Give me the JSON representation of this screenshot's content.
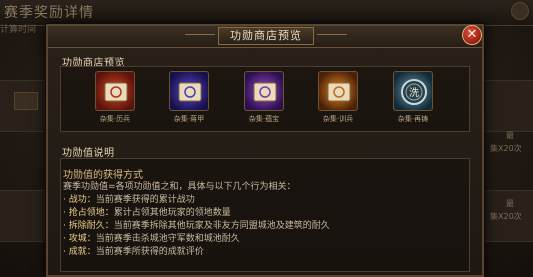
{
  "background": {
    "title": "赛季奖励详情",
    "subtitle": "计算时间",
    "right_texts": [
      "最",
      "集X20次",
      "最",
      "集X20次"
    ]
  },
  "modal": {
    "title": "功勋商店预览",
    "close_icon": "close-icon",
    "shop_section_label": "功勋商店预览",
    "shop_items": [
      {
        "name": "杂集·历兵",
        "icon": "scroll-red-icon",
        "color": "#b03022"
      },
      {
        "name": "杂集·蒋甲",
        "icon": "scroll-purple-icon",
        "color": "#4a3fa8"
      },
      {
        "name": "杂集·蕴宝",
        "icon": "scroll-violet-icon",
        "color": "#7a3aa8"
      },
      {
        "name": "杂集·训兵",
        "icon": "scroll-orange-icon",
        "color": "#c36a18"
      },
      {
        "name": "杂集·再铸",
        "icon": "coin-icon",
        "color": "#5a8aa0"
      }
    ],
    "desc_section_label": "功勋值说明",
    "desc_heading": "功勋值的获得方式",
    "desc_intro": "赛季功勋值=各项功勋值之和，具体与以下几个行为相关：",
    "desc_items": [
      {
        "key": "· 战功：",
        "text": "当前赛季获得的累计战功"
      },
      {
        "key": "· 抢占领地：",
        "text": "累计占领其他玩家的领地数量"
      },
      {
        "key": "· 拆除耐久：",
        "text": "当前赛季拆除其他玩家及非友方同盟城池及建筑的耐久"
      },
      {
        "key": "· 攻城：",
        "text": "当前赛季击杀城池守军数和城池耐久"
      },
      {
        "key": "· 成就：",
        "text": "当前赛季所获得的成就评价"
      }
    ]
  }
}
